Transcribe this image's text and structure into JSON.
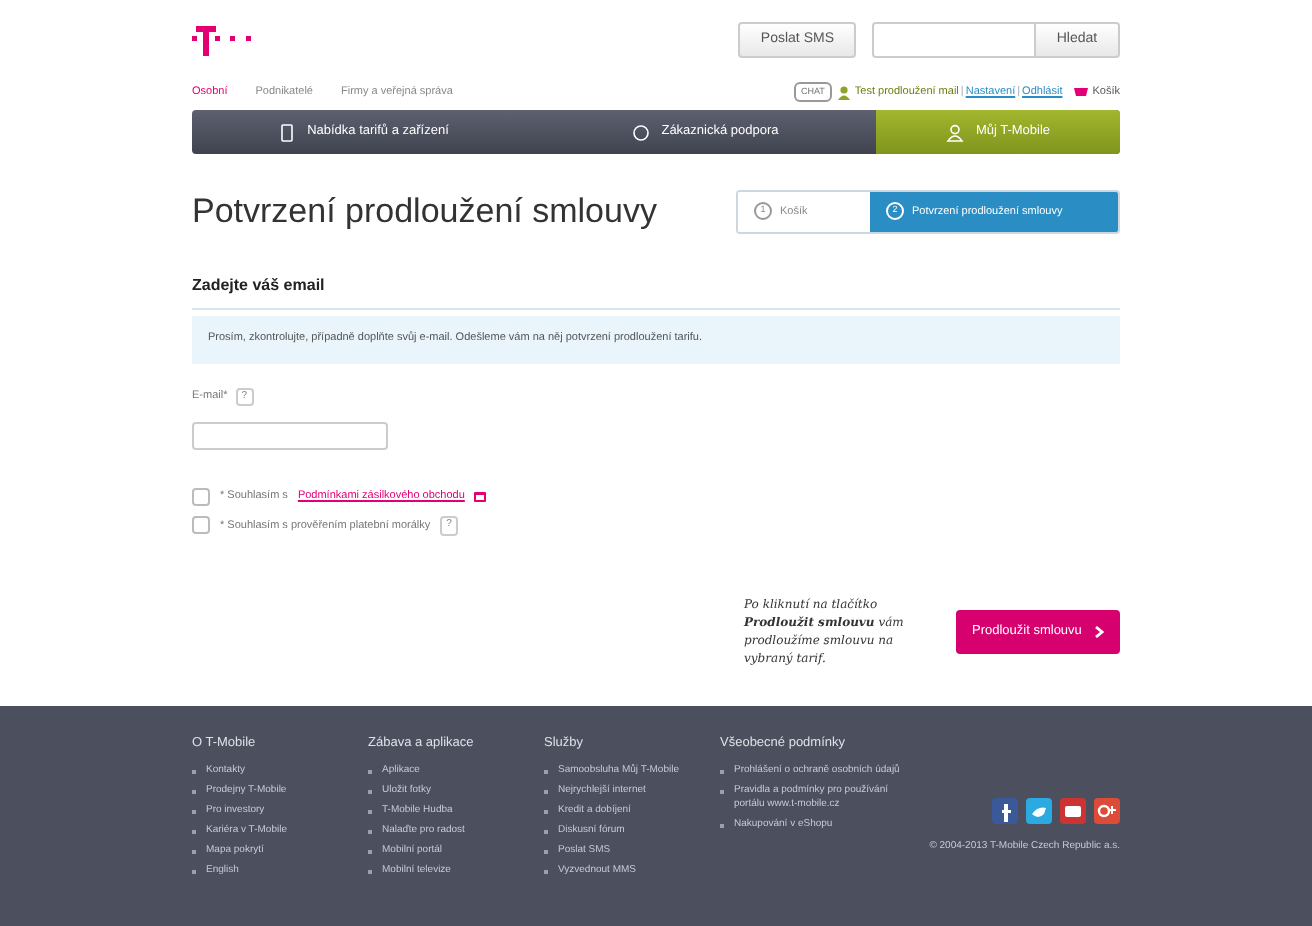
{
  "header": {
    "sms_button": "Poslat SMS",
    "search_button": "Hledat",
    "segments": [
      {
        "label": "Osobní",
        "selected": true
      },
      {
        "label": "Podnikatelé",
        "selected": false
      },
      {
        "label": "Firmy a veřejná správa",
        "selected": false
      }
    ],
    "chat": "CHAT",
    "user": "Test prodloužení mail",
    "separator": "|",
    "links": [
      "Nastavení",
      "Odhlásit"
    ],
    "cart": "Košík"
  },
  "nav": [
    {
      "label": "Nabídka tarifů a zařízení",
      "selected": false,
      "kind": "phone"
    },
    {
      "label": "Zákaznická podpora",
      "selected": false,
      "kind": "support"
    },
    {
      "label": "Můj T-Mobile",
      "selected": true,
      "kind": "user"
    }
  ],
  "title": "Potvrzení prodloužení smlouvy",
  "steps": [
    {
      "number": "1",
      "label": "Košík",
      "selected": false
    },
    {
      "number": "2",
      "label": "Potvrzení prodloužení smlouvy",
      "selected": true
    }
  ],
  "section_title": "Zadejte váš email",
  "info": "Prosím, zkontrolujte, případně doplňte svůj e-mail. Odešleme vám na něj potvrzení prodloužení tarifu.",
  "email": {
    "label": "E-mail*",
    "help": "?"
  },
  "agreements": [
    {
      "kind": "link",
      "prefix": "* Souhlasím s",
      "link": "Podmínkami zásilkového obchodu",
      "checked": false
    },
    {
      "kind": "help",
      "prefix": "* Souhlasím s prověřením platební morálky",
      "help": "?",
      "checked": false
    }
  ],
  "note": "Po kliknutí na tlačítko **Prodloužit smlouvu** vám prodloužíme smlouvu na *vybraný tarif*.",
  "submit": "Prodloužit smlouvu",
  "footer": {
    "columns": [
      {
        "heading": "O T-Mobile",
        "items": [
          "Kontakty",
          "Prodejny T-Mobile",
          "Pro investory",
          "Kariéra v T-Mobile",
          "Mapa pokrytí",
          "English"
        ]
      },
      {
        "heading": "Zábava a aplikace",
        "items": [
          "Aplikace",
          "Uložit fotky",
          "T-Mobile Hudba",
          "Nalaďte pro radost",
          "Mobilní portál",
          "Mobilní televize"
        ]
      },
      {
        "heading": "Služby",
        "items": [
          "Samoobsluha Můj T-Mobile",
          "Nejrychlejší internet",
          "Kredit a dobíjení",
          "Diskusní fórum",
          "Poslat SMS",
          "Vyzvednout MMS"
        ]
      },
      {
        "heading": "Všeobecné podmínky",
        "items": [
          "Prohlášení o ochraně osobních údajů",
          "Pravidla a podmínky pro používání portálu www.t-mobile.cz",
          "Nakupování v eShopu"
        ]
      }
    ],
    "copyright": "© 2004-2013 T-Mobile Czech Republic a.s."
  }
}
